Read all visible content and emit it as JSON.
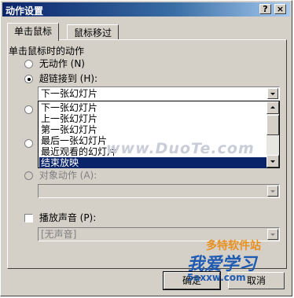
{
  "window": {
    "title": "动作设置",
    "help_glyph": "?",
    "close_glyph": "×"
  },
  "tabs": [
    {
      "label": "单击鼠标"
    },
    {
      "label": "鼠标移过"
    }
  ],
  "group_label": "单击鼠标时的动作",
  "radios": {
    "none": "无动作 (N)",
    "hyperlink": "超链接到 (H):",
    "object_action": "对象动作 (A):"
  },
  "hyperlink_combo": {
    "value": "下一张幻灯片"
  },
  "dropdown_options": [
    {
      "label": "下一张幻灯片",
      "selected": false
    },
    {
      "label": "上一张幻灯片",
      "selected": false
    },
    {
      "label": "第一张幻灯片",
      "selected": false
    },
    {
      "label": "最后一张幻灯片",
      "selected": false
    },
    {
      "label": "最近观看的幻灯片",
      "selected": false
    },
    {
      "label": "结束放映",
      "selected": true
    }
  ],
  "sound": {
    "label": "播放声音 (P):",
    "value": "[无声音]"
  },
  "buttons": {
    "ok": "确定",
    "cancel": "取消"
  },
  "watermarks": {
    "duote": "www.DuoTe.com",
    "duote_cn": "多特软件站",
    "site": "我爱学习",
    "site_url": "5axxw.com"
  },
  "colors": {
    "titlebar": "#0a246a",
    "selection": "#0a246a",
    "dialog": "#d4d0c8",
    "watermark_blue": "#1f5bb3",
    "watermark_orange": "#e89020"
  }
}
